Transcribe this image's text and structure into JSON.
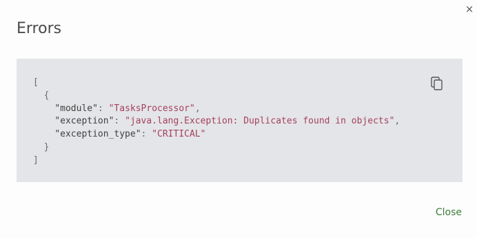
{
  "dialog": {
    "title": "Errors",
    "close_x": "×",
    "close_label": "Close",
    "copy_icon": "copy-icon"
  },
  "code": {
    "open_bracket": "[",
    "open_brace": "{",
    "entries": [
      {
        "key": "\"module\"",
        "value": "\"TasksProcessor\"",
        "trailing": ","
      },
      {
        "key": "\"exception\"",
        "value": "\"java.lang.Exception: Duplicates found in objects\"",
        "trailing": ","
      },
      {
        "key": "\"exception_type\"",
        "value": "\"CRITICAL\"",
        "trailing": ""
      }
    ],
    "close_brace": "}",
    "close_bracket": "]"
  },
  "colors": {
    "panel_bg": "#e4e5e8",
    "string": "#a4405b",
    "close_button": "#3e7a38",
    "title": "#4a4a4a"
  }
}
